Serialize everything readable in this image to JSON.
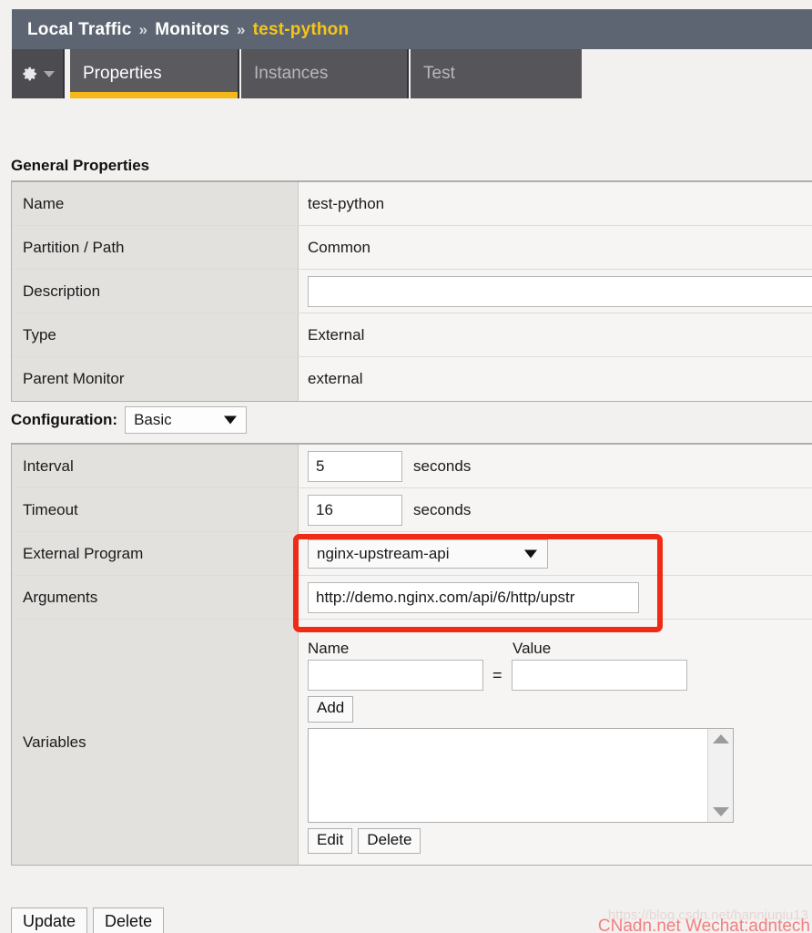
{
  "breadcrumb": {
    "root": "Local Traffic",
    "separator": "»",
    "section": "Monitors",
    "current": "test-python",
    "accent_color": "#f5c518",
    "bar_color": "#5d6573"
  },
  "tabs": {
    "gear_icon": "gear-icon",
    "chevron_icon": "chevron-down-icon",
    "items": [
      {
        "label": "Properties",
        "active": true
      },
      {
        "label": "Instances",
        "active": false
      },
      {
        "label": "Test",
        "active": false
      }
    ],
    "active_underline_color": "#f5b81a"
  },
  "general_properties": {
    "title": "General Properties",
    "rows": [
      {
        "label": "Name",
        "value": "test-python",
        "kind": "text"
      },
      {
        "label": "Partition / Path",
        "value": "Common",
        "kind": "text"
      },
      {
        "label": "Description",
        "value": "",
        "kind": "input"
      },
      {
        "label": "Type",
        "value": "External",
        "kind": "text"
      },
      {
        "label": "Parent Monitor",
        "value": "external",
        "kind": "text"
      }
    ]
  },
  "configuration": {
    "label": "Configuration:",
    "mode": "Basic",
    "interval": {
      "label": "Interval",
      "value": "5",
      "unit": "seconds"
    },
    "timeout": {
      "label": "Timeout",
      "value": "16",
      "unit": "seconds"
    },
    "external_program": {
      "label": "External Program",
      "value": "nginx-upstream-api"
    },
    "arguments": {
      "label": "Arguments",
      "value": "http://demo.nginx.com/api/6/http/upstr"
    },
    "variables": {
      "label": "Variables",
      "name_header": "Name",
      "value_header": "Value",
      "equals": "=",
      "name_value": "",
      "value_value": "",
      "add_label": "Add",
      "edit_label": "Edit",
      "delete_label": "Delete",
      "list_items": []
    }
  },
  "footer": {
    "update_label": "Update",
    "delete_label": "Delete"
  },
  "watermark": {
    "url": "https://blog.csdn.net/hanniuniu13",
    "text": "CNadn.net Wechat:adntech",
    "color": "#f08080"
  },
  "highlight": {
    "color": "#ef2b16",
    "note": "external-program-and-arguments"
  }
}
